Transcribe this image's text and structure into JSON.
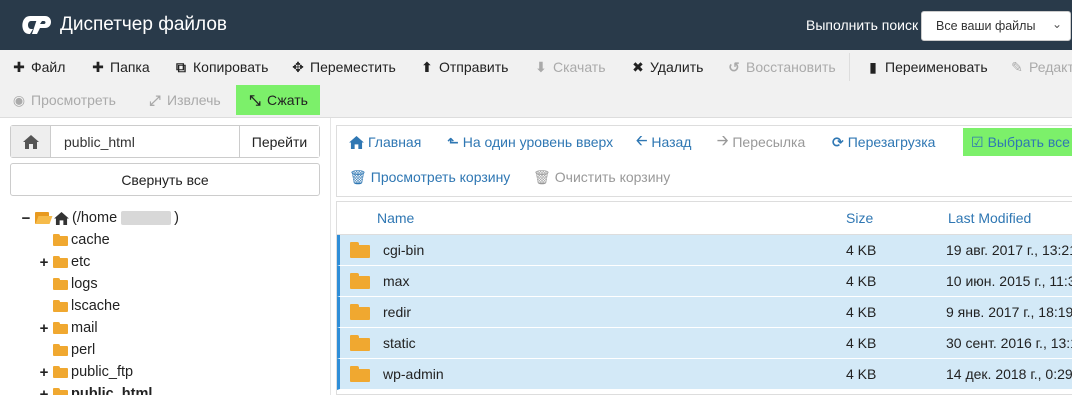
{
  "header": {
    "app_title": "Диспетчер файлов",
    "search_label": "Выполнить поиск",
    "search_scope": "Все ваши файлы"
  },
  "toolbar": {
    "row1": [
      {
        "label": "Файл",
        "icon": "plus-icon",
        "enabled": true
      },
      {
        "label": "Папка",
        "icon": "plus-icon",
        "enabled": true
      },
      {
        "label": "Копировать",
        "icon": "copy-icon",
        "enabled": true
      },
      {
        "label": "Переместить",
        "icon": "move-icon",
        "enabled": true
      },
      {
        "label": "Отправить",
        "icon": "upload-icon",
        "enabled": true
      },
      {
        "label": "Скачать",
        "icon": "download-icon",
        "enabled": false
      },
      {
        "label": "Удалить",
        "icon": "close-icon",
        "enabled": true
      },
      {
        "label": "Восстановить",
        "icon": "undo-icon",
        "enabled": false
      },
      {
        "label": "Переименовать",
        "icon": "file-icon",
        "enabled": true
      },
      {
        "label": "Редакт",
        "icon": "pencil-icon",
        "enabled": false
      }
    ],
    "row2": [
      {
        "label": "Просмотреть",
        "icon": "eye-icon",
        "enabled": false
      },
      {
        "label": "Извлечь",
        "icon": "expand-icon",
        "enabled": false
      },
      {
        "label": "Сжать",
        "icon": "compress-icon",
        "enabled": true,
        "active": true
      }
    ]
  },
  "left_panel": {
    "path_value": "public_html",
    "go_label": "Перейти",
    "collapse_label": "Свернуть все",
    "tree": [
      {
        "label": "(/home",
        "toggle": "−",
        "type": "home"
      },
      {
        "label": "cache",
        "toggle": ""
      },
      {
        "label": "etc",
        "toggle": "+"
      },
      {
        "label": "logs",
        "toggle": ""
      },
      {
        "label": "lscache",
        "toggle": ""
      },
      {
        "label": "mail",
        "toggle": "+"
      },
      {
        "label": "perl",
        "toggle": ""
      },
      {
        "label": "public_ftp",
        "toggle": "+"
      },
      {
        "label": "public_html",
        "toggle": "+",
        "bold": true
      }
    ]
  },
  "nav": {
    "row1": [
      {
        "label": "Главная",
        "icon": "home-icon",
        "enabled": true
      },
      {
        "label": "На один уровень вверх",
        "icon": "level-up-icon",
        "enabled": true
      },
      {
        "label": "Назад",
        "icon": "arrow-left-icon",
        "enabled": true
      },
      {
        "label": "Пересылка",
        "icon": "arrow-right-icon",
        "enabled": false
      },
      {
        "label": "Перезагрузка",
        "icon": "refresh-icon",
        "enabled": true
      },
      {
        "label": "Выбрать все",
        "icon": "checkbox-icon",
        "enabled": true,
        "active": true
      }
    ],
    "row2": [
      {
        "label": "Просмотреть корзину",
        "icon": "trash-icon",
        "enabled": true
      },
      {
        "label": "Очистить корзину",
        "icon": "trash-icon",
        "enabled": false
      }
    ]
  },
  "table": {
    "headers": {
      "name": "Name",
      "size": "Size",
      "modified": "Last Modified"
    },
    "rows": [
      {
        "name": "cgi-bin",
        "size": "4 KB",
        "modified": "19 авг. 2017 г., 13:21"
      },
      {
        "name": "max",
        "size": "4 KB",
        "modified": "10 июн. 2015 г., 11:3"
      },
      {
        "name": "redir",
        "size": "4 KB",
        "modified": "9 янв. 2017 г., 18:19"
      },
      {
        "name": "static",
        "size": "4 KB",
        "modified": "30 сент. 2016 г., 13:1"
      },
      {
        "name": "wp-admin",
        "size": "4 KB",
        "modified": "14 дек. 2018 г., 0:29"
      }
    ]
  },
  "colors": {
    "header_bg": "#293a4a",
    "active_highlight": "#7cf06a",
    "link_blue": "#2f77b3",
    "selected_row": "#d3e9f7",
    "folder": "#f0a830"
  }
}
